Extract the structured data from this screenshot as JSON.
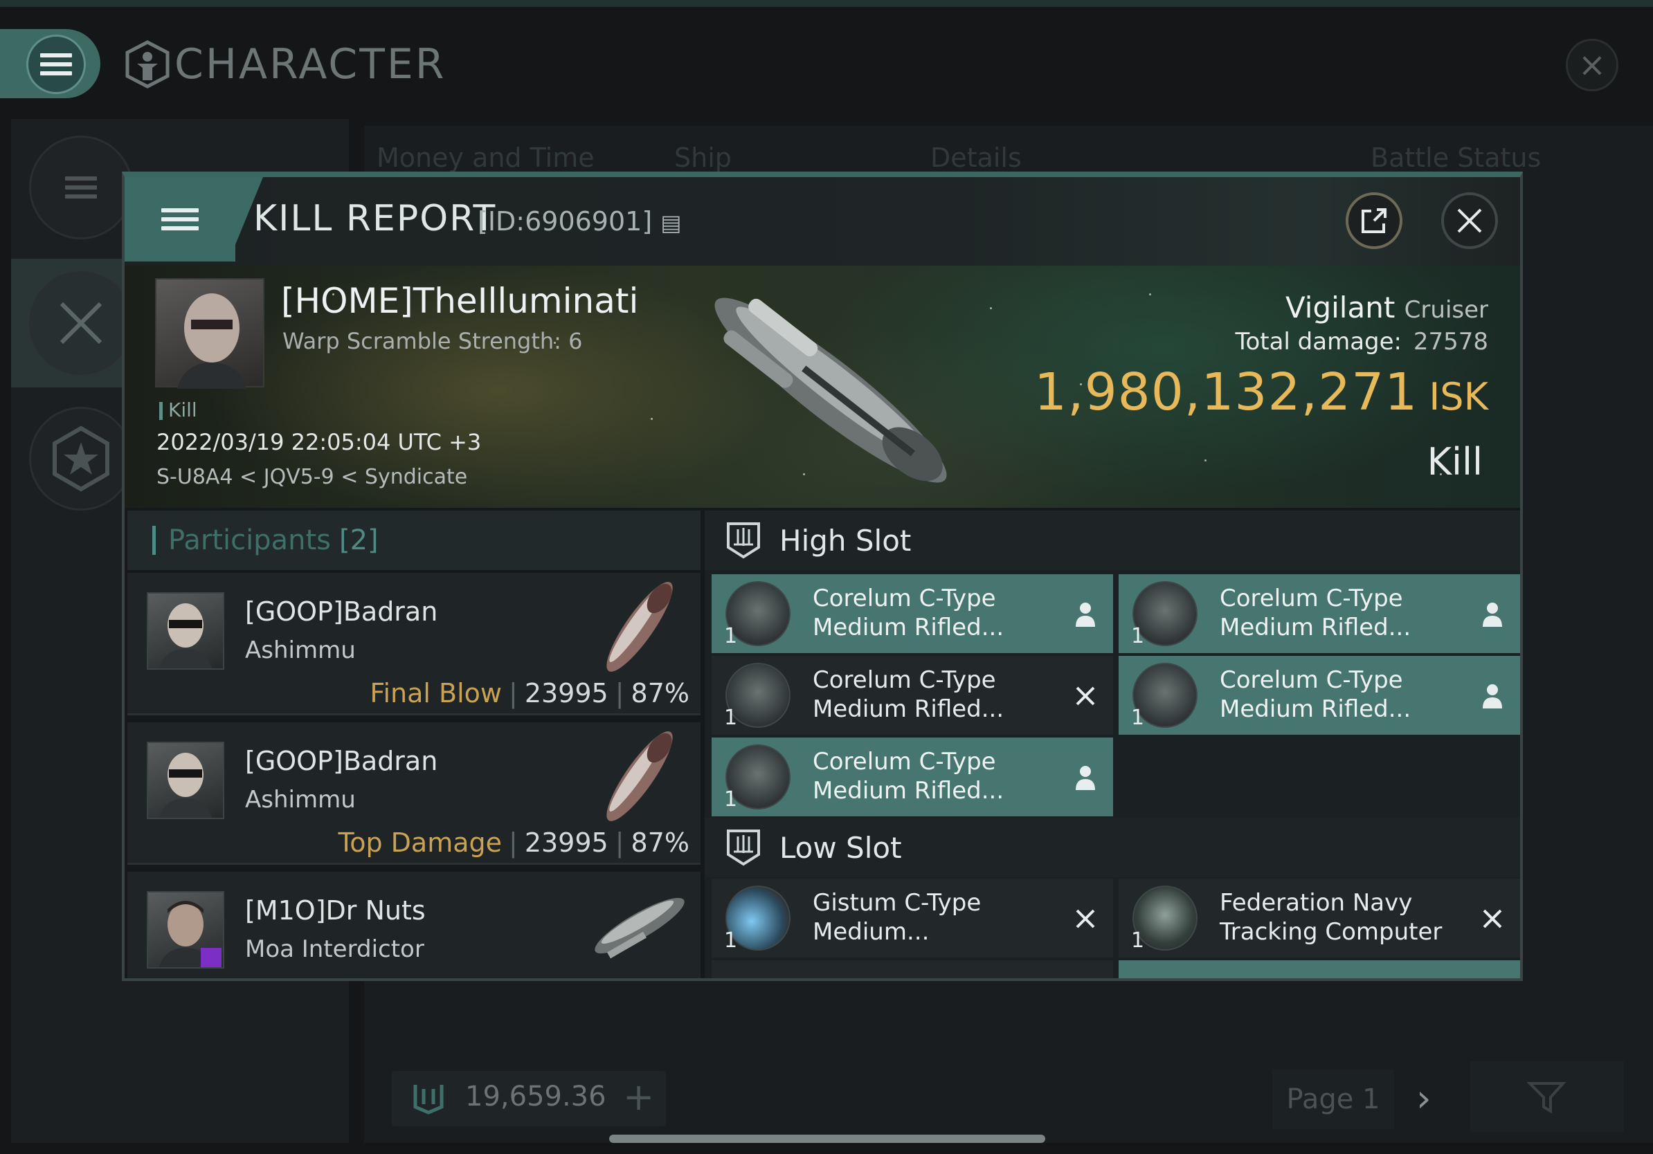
{
  "background": {
    "title": "CHARACTER",
    "tabs": [
      "Money and Time",
      "Ship",
      "Details",
      "Battle Status"
    ],
    "isk_balance": "19,659.36",
    "page_label": "Page 1"
  },
  "modal": {
    "title": "KILL REPORT",
    "report_id": "[ID:6906901]",
    "victim": {
      "name": "[HOME]TheIlluminati",
      "warp_scramble": "Warp Scramble Strength: 6",
      "tag": "Kill",
      "datetime": "2022/03/19 22:05:04 UTC +3",
      "location": "S-U8A4 < JQV5-9 < Syndicate"
    },
    "ship": {
      "name": "Vigilant",
      "class": "Cruiser"
    },
    "damage_label": "Total damage:",
    "damage_value": "27578",
    "isk_value": "1,980,132,271",
    "isk_unit": "ISK",
    "result": "Kill",
    "participants": {
      "label": "Participants",
      "count": "[2]",
      "rows": [
        {
          "name": "[GOOP]Badran",
          "ship": "Ashimmu",
          "tag": "Final Blow",
          "damage": "23995",
          "percent": "87%"
        },
        {
          "name": "[GOOP]Badran",
          "ship": "Ashimmu",
          "tag": "Top Damage",
          "damage": "23995",
          "percent": "87%"
        },
        {
          "name": "[M1O]Dr Nuts",
          "ship": "Moa Interdictor",
          "tag": "",
          "damage": "",
          "percent": ""
        }
      ]
    },
    "high_slot": {
      "title": "High Slot",
      "modules": [
        {
          "name_line1": "Corelum C-Type",
          "name_line2": "Medium Rifled...",
          "qty": "1",
          "status": "fitted"
        },
        {
          "name_line1": "Corelum C-Type",
          "name_line2": "Medium Rifled...",
          "qty": "1",
          "status": "fitted"
        },
        {
          "name_line1": "Corelum C-Type",
          "name_line2": "Medium Rifled...",
          "qty": "1",
          "status": "destroyed"
        },
        {
          "name_line1": "Corelum C-Type",
          "name_line2": "Medium Rifled...",
          "qty": "1",
          "status": "fitted"
        },
        {
          "name_line1": "Corelum C-Type",
          "name_line2": "Medium Rifled...",
          "qty": "1",
          "status": "fitted"
        }
      ]
    },
    "low_slot": {
      "title": "Low Slot",
      "modules": [
        {
          "name_line1": "Gistum C-Type",
          "name_line2": "Medium...",
          "qty": "1",
          "status": "destroyed"
        },
        {
          "name_line1": "Federation Navy",
          "name_line2": "Tracking Computer",
          "qty": "1",
          "status": "destroyed"
        }
      ]
    }
  },
  "colors": {
    "accent_teal": "#46766f",
    "isk_gold": "#e7b95a",
    "tag_gold": "#c9a253"
  }
}
